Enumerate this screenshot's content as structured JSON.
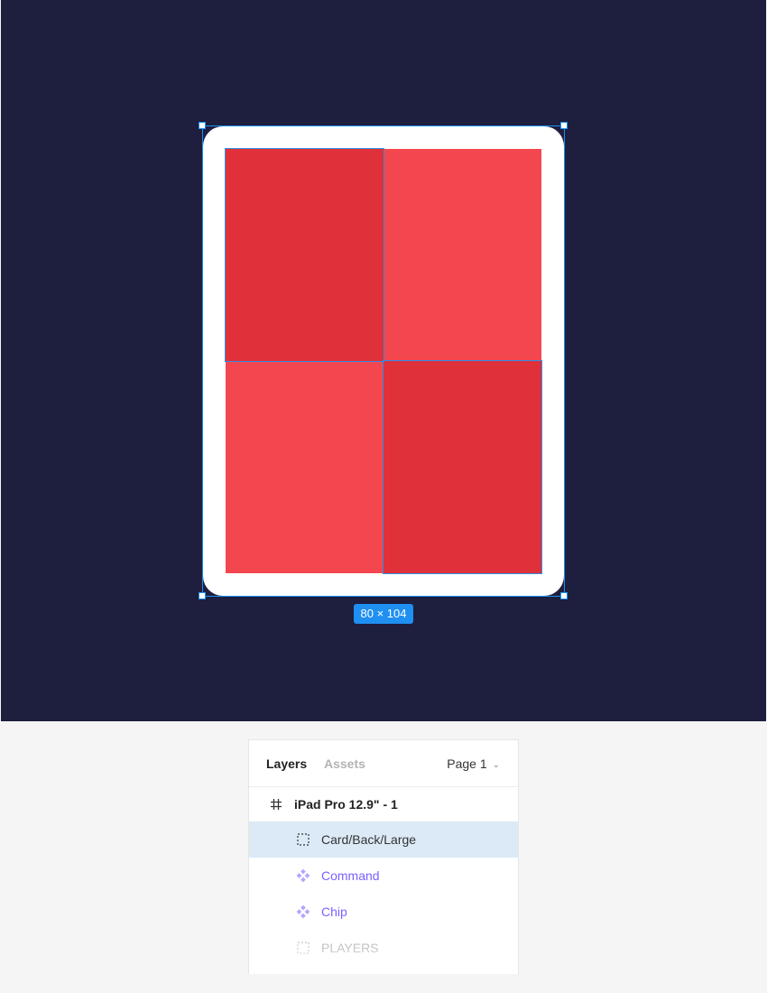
{
  "canvas": {
    "background": "#1e1e3f",
    "card_back_color": "#ffffff",
    "quadrant_dark_color": "#e0303a",
    "quadrant_light_color": "#f4464e",
    "selection_color": "#1c8ff0",
    "size_label": "80 × 104"
  },
  "layers_panel": {
    "tabs": [
      {
        "label": "Layers",
        "active": true
      },
      {
        "label": "Assets",
        "active": false
      }
    ],
    "page_select": {
      "value": "Page 1",
      "icon": "chevron-down-icon"
    },
    "layers": [
      {
        "label": "iPad Pro 12.9\" - 1",
        "icon": "hash-frame-icon",
        "type": "frame"
      },
      {
        "label": "Card/Back/Large",
        "icon": "dashed-group-icon",
        "type": "frame",
        "selected": true
      },
      {
        "label": "Command",
        "icon": "component-instance-icon",
        "type": "instance"
      },
      {
        "label": "Chip",
        "icon": "component-instance-icon",
        "type": "instance"
      },
      {
        "label": "PLAYERS",
        "icon": "dashed-group-icon",
        "type": "frame"
      }
    ],
    "instance_color": "#7b61ff"
  }
}
